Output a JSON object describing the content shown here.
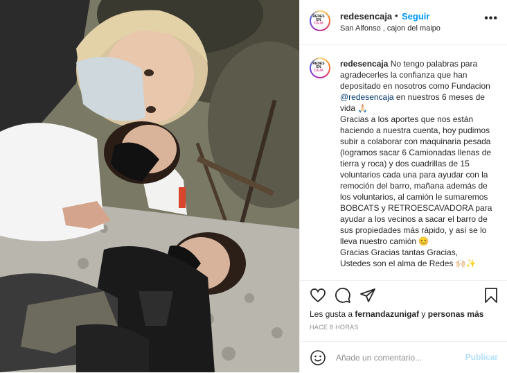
{
  "post": {
    "username": "redesencaja",
    "dot": "•",
    "follow_label": "Seguir",
    "location": "San Alfonso , cajon del maipo",
    "more_label": "•••",
    "logo_lines": [
      "REDES",
      "EN",
      "CAJA"
    ]
  },
  "caption": {
    "username": "redesencaja",
    "part1": " No tengo palabras para agradecerles la confianza que han depositado en nosotros como Fundacion ",
    "mention": "@redesencaja",
    "part2": " en nuestros 6 meses de vida 🙏🏻",
    "part3": "Gracias a los aportes que nos están haciendo a nuestra cuenta, hoy pudimos subir a colaborar con maquinaria pesada (logramos sacar 6 Camionadas llenas de tierra y roca) y dos cuadrillas de 15 voluntarios cada una para ayudar con la remoción del barro, mañana además de los voluntarios, al camión le sumaremos BOBCATS y RETROESCAVADORA para ayudar a los vecinos a sacar el barro de sus propiedades más rápido, y así se lo lleva nuestro camión 😊",
    "part4": "Gracias Gracias tantas Gracias,",
    "part5": "Ustedes son el alma de Redes 🙌🏻✨"
  },
  "actions": {
    "icons": [
      "heart-icon",
      "comment-icon",
      "share-icon",
      "bookmark-icon"
    ]
  },
  "likes": {
    "prefix": "Les gusta a ",
    "user": "fernandazunigaf",
    "middle": " y ",
    "others": "personas más"
  },
  "timestamp": "HACE 8 HORAS",
  "comment_box": {
    "placeholder": "Añade un comentario...",
    "post_label": "Publicar"
  },
  "colors": {
    "link": "#0095f6",
    "mention": "#00376b",
    "post_disabled": "#b2dffc",
    "muted": "#8e8e8e"
  }
}
